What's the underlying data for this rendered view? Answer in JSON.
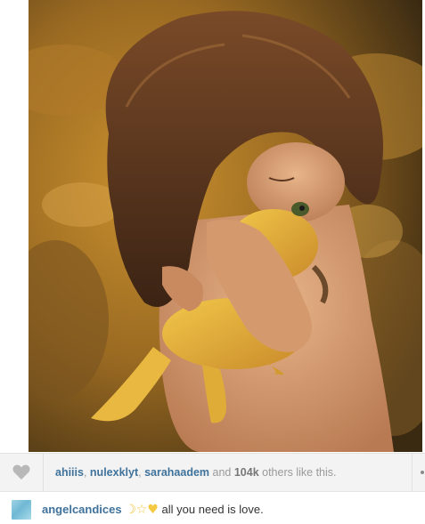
{
  "post": {
    "photo_icon": "photo-girl-hugging-frog",
    "likes": {
      "heart_icon": "heart-icon",
      "users": [
        "ahiiis",
        "nulexklyt",
        "sarahaadem"
      ],
      "separator": ", ",
      "and_text": " and ",
      "count": "104k",
      "suffix": " others like this."
    },
    "caption": {
      "username": "angelcandices",
      "emojis": [
        "☽",
        "☆",
        "♥"
      ],
      "text": "all you need is love."
    },
    "colors": {
      "link": "#3f729b",
      "muted": "#999999",
      "bar_bg": "#f3f3f3"
    }
  }
}
